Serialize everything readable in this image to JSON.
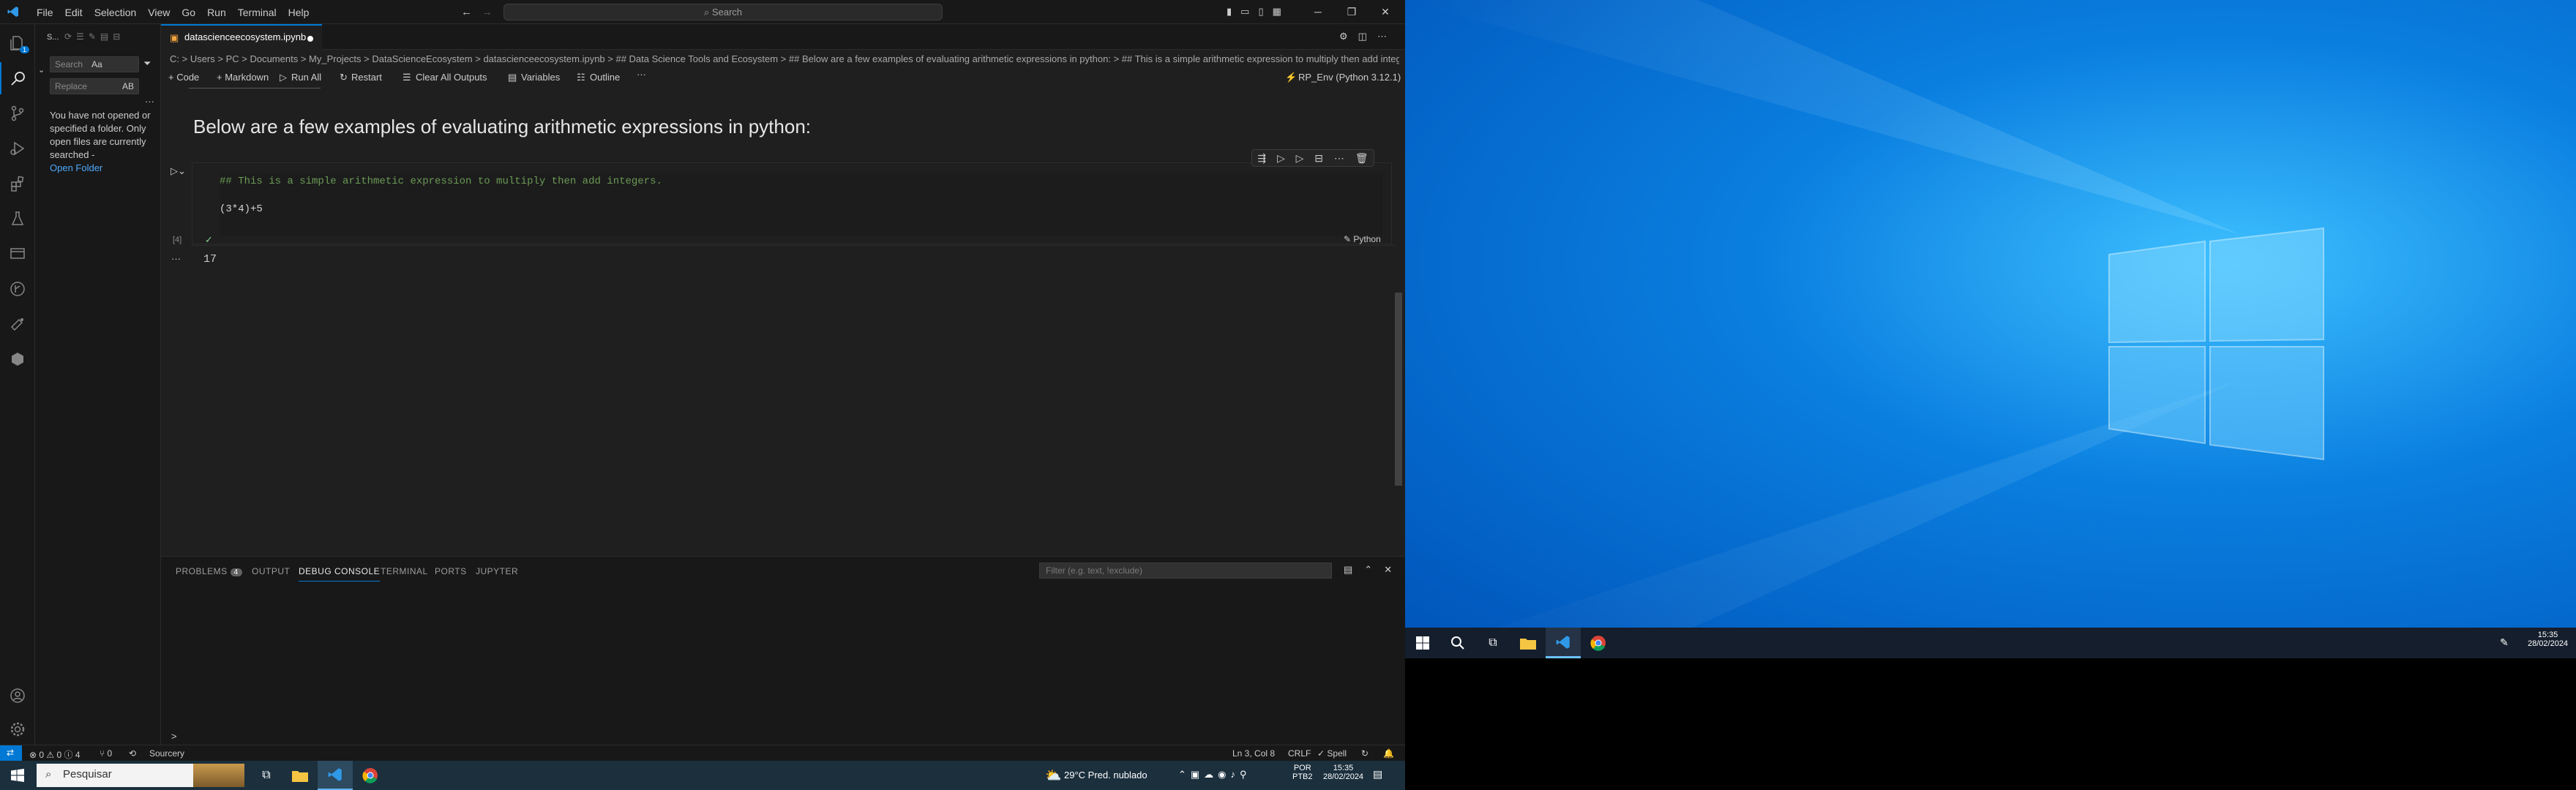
{
  "vscode": {
    "menu": [
      "File",
      "Edit",
      "Selection",
      "View",
      "Go",
      "Run",
      "Terminal",
      "Help"
    ],
    "search_placeholder": "Search",
    "sidebar": {
      "header": "S...",
      "search_placeholder": "Search",
      "search_opts": "Aa",
      "replace_placeholder": "Replace",
      "replace_btn": "AB",
      "message": "You have not opened or specified a folder. Only open files are currently searched -",
      "open_folder": "Open Folder",
      "search_badge": "1"
    },
    "tab": {
      "label": "datascienceecosystem.ipynb"
    },
    "breadcrumb": "C: > Users > PC > Documents > My_Projects > DataScienceEcosystem > datascienceecosystem.ipynb > ## Data Science Tools and Ecosystem > ## Below are a few examples of evaluating arithmetic expressions in python: > ## This is a simple arithmetic expression to multiply then add integers",
    "toolbar": {
      "code": "+ Code",
      "markdown": "+ Markdown",
      "run_all": "Run All",
      "restart": "Restart",
      "clear_outputs": "Clear All Outputs",
      "variables": "Variables",
      "outline": "Outline",
      "more": "···",
      "kernel": "RP_Env (Python 3.12.1)"
    },
    "notebook": {
      "heading": "Below are a few examples of evaluating arithmetic expressions in python:",
      "cell": {
        "comment": "## This is a simple arithmetic expression to multiply then add integers.",
        "code": "(3*4)+5",
        "exec_count": "[4]",
        "language": "Python",
        "status_check": "✓"
      },
      "output_value": "17",
      "output_dots": "···"
    },
    "panel": {
      "tabs": [
        "PROBLEMS",
        "OUTPUT",
        "DEBUG CONSOLE",
        "TERMINAL",
        "PORTS",
        "JUPYTER"
      ],
      "problems_count": "4",
      "filter_placeholder": "Filter (e.g. text, !exclude)",
      "prompt": ">"
    },
    "status": {
      "problems": "⊗ 0 ⚠ 0 ⓘ 4",
      "ports": "⑂ 0",
      "sourcery": "Sourcery",
      "position": "Ln 3, Col 8",
      "eol": "CRLF",
      "spell": "✓ Spell"
    }
  },
  "host_taskbar": {
    "search_placeholder": "Pesquisar",
    "weather": "29°C  Pred. nublado",
    "lang1": "POR",
    "lang2": "PTB2",
    "time": "15:35",
    "date": "28/02/2024"
  },
  "remote": {
    "time": "15:35",
    "date": "28/02/2024"
  }
}
